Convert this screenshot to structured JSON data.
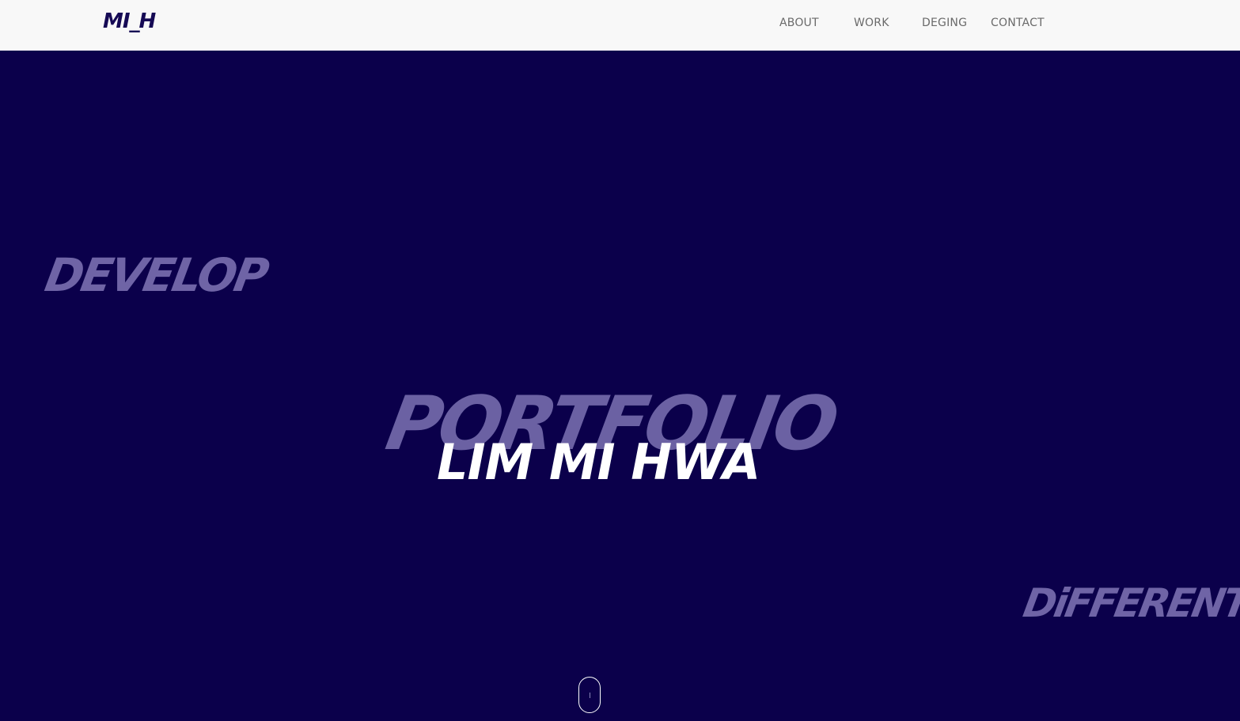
{
  "nav": {
    "logo": "MI_H",
    "links": [
      "ABOUT",
      "WORK",
      "DEGING",
      "CONTACT"
    ]
  },
  "hero": {
    "word_develop": "DEVELOP",
    "word_portfolio": "PORTFOLIO",
    "word_different": "DiFFERENT",
    "name": "LIM MI HWA"
  },
  "colors": {
    "hero_background": "#0b004b",
    "navbar_background": "#f8f8f8",
    "brush_text": "#6f64a6",
    "logo": "#160a55",
    "name_text": "#ffffff"
  },
  "icons": {
    "scroll_indicator": "mouse-scroll-icon"
  }
}
